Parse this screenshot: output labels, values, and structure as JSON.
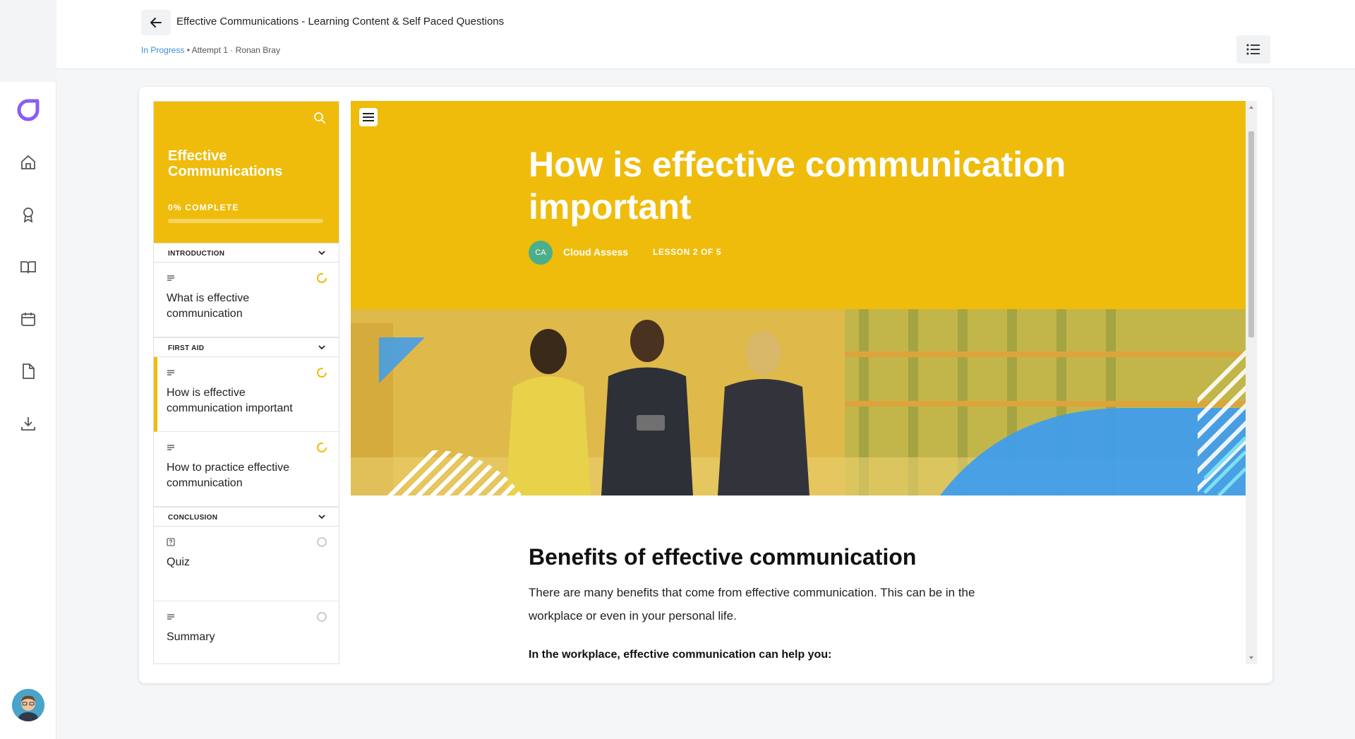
{
  "header": {
    "title": "Effective Communications - Learning Content & Self Paced Questions",
    "status": "In Progress",
    "attempt": "• Attempt 1 · Ronan Bray"
  },
  "rail": {
    "items": [
      {
        "icon": "home-icon"
      },
      {
        "icon": "award-icon"
      },
      {
        "icon": "book-icon"
      },
      {
        "icon": "calendar-icon"
      },
      {
        "icon": "document-icon"
      },
      {
        "icon": "download-icon"
      }
    ]
  },
  "sidebar": {
    "course_title": "Effective Communications",
    "progress_label": "0% COMPLETE",
    "progress_fraction": 0,
    "sections": [
      {
        "label": "INTRODUCTION"
      },
      {
        "label": "FIRST AID"
      },
      {
        "label": "CONCLUSION"
      }
    ],
    "lessons": [
      {
        "title": "What is effective communication",
        "type": "text-icon",
        "status": "in-progress"
      },
      {
        "title": "How is effective communication important",
        "type": "text-icon",
        "status": "in-progress"
      },
      {
        "title": "How to practice effective communication",
        "type": "text-icon",
        "status": "in-progress"
      },
      {
        "title": "Quiz",
        "type": "quiz-icon",
        "status": "not-started"
      },
      {
        "title": "Summary",
        "type": "text-icon",
        "status": "not-started"
      }
    ]
  },
  "lesson": {
    "heading": "How is effective communication important",
    "author_initials": "CA",
    "author": "Cloud Assess",
    "lesson_count": "LESSON 2 OF 5",
    "body_title": "Benefits of effective communication",
    "body_para": "There are many benefits that come from effective communication. This can be in the workplace or even in your personal life.",
    "body_sub": "In the workplace, effective communication can help you:"
  },
  "colors": {
    "accent": "#efbc0b",
    "link": "#3b8dd6",
    "brand": "#8b5cf6",
    "blue": "#3d9cf0"
  }
}
